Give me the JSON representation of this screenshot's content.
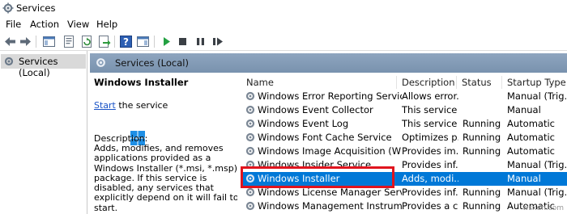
{
  "window": {
    "title": "Services"
  },
  "menu": [
    "File",
    "Action",
    "View",
    "Help"
  ],
  "toolbar": {
    "icons": [
      "back-arrow-icon",
      "forward-arrow-icon",
      "console-tree-icon",
      "properties-icon",
      "refresh-icon",
      "export-list-icon",
      "help-icon",
      "action-pane-icon",
      "start-icon",
      "stop-icon",
      "pause-icon",
      "restart-icon"
    ]
  },
  "tree": {
    "root_label": "Services (Local)"
  },
  "main": {
    "header_label": "Services (Local)",
    "selected_service_title": "Windows Installer",
    "start_link": "Start",
    "start_suffix": " the service",
    "description_label": "Description:",
    "description_text": "Adds, modifies, and removes applications provided as a Windows Installer (*.msi, *.msp) package. If this service is disabled, any services that explicitly depend on it will fail to start."
  },
  "columns": {
    "name": "Name",
    "description": "Description",
    "status": "Status",
    "startup": "Startup Type"
  },
  "services": [
    {
      "name": "Windows Error Reporting Service",
      "description": "Allows error...",
      "status": "",
      "startup": "Manual (Trig..."
    },
    {
      "name": "Windows Event Collector",
      "description": "This service ...",
      "status": "",
      "startup": "Manual"
    },
    {
      "name": "Windows Event Log",
      "description": "This service ...",
      "status": "Running",
      "startup": "Automatic"
    },
    {
      "name": "Windows Font Cache Service",
      "description": "Optimizes p...",
      "status": "Running",
      "startup": "Automatic"
    },
    {
      "name": "Windows Image Acquisition (WIA)",
      "description": "Provides im...",
      "status": "Running",
      "startup": "Automatic"
    },
    {
      "name": "Windows Insider Service",
      "description": "Provides inf...",
      "status": "",
      "startup": "Manual (Trig..."
    },
    {
      "name": "Windows Installer",
      "description": "Adds, modi...",
      "status": "",
      "startup": "Manual"
    },
    {
      "name": "Windows License Manager Service",
      "description": "Provides inf...",
      "status": "Running",
      "startup": "Manual (Trig..."
    },
    {
      "name": "Windows Management Instrument...",
      "description": "Provides a c...",
      "status": "Running",
      "startup": "Automatic"
    }
  ],
  "watermark": "wsxdn.com",
  "colors": {
    "selection": "#0078d7",
    "highlight_box": "#e0141e",
    "header_bar": "#8ea5bf",
    "link": "#1a53c6"
  }
}
